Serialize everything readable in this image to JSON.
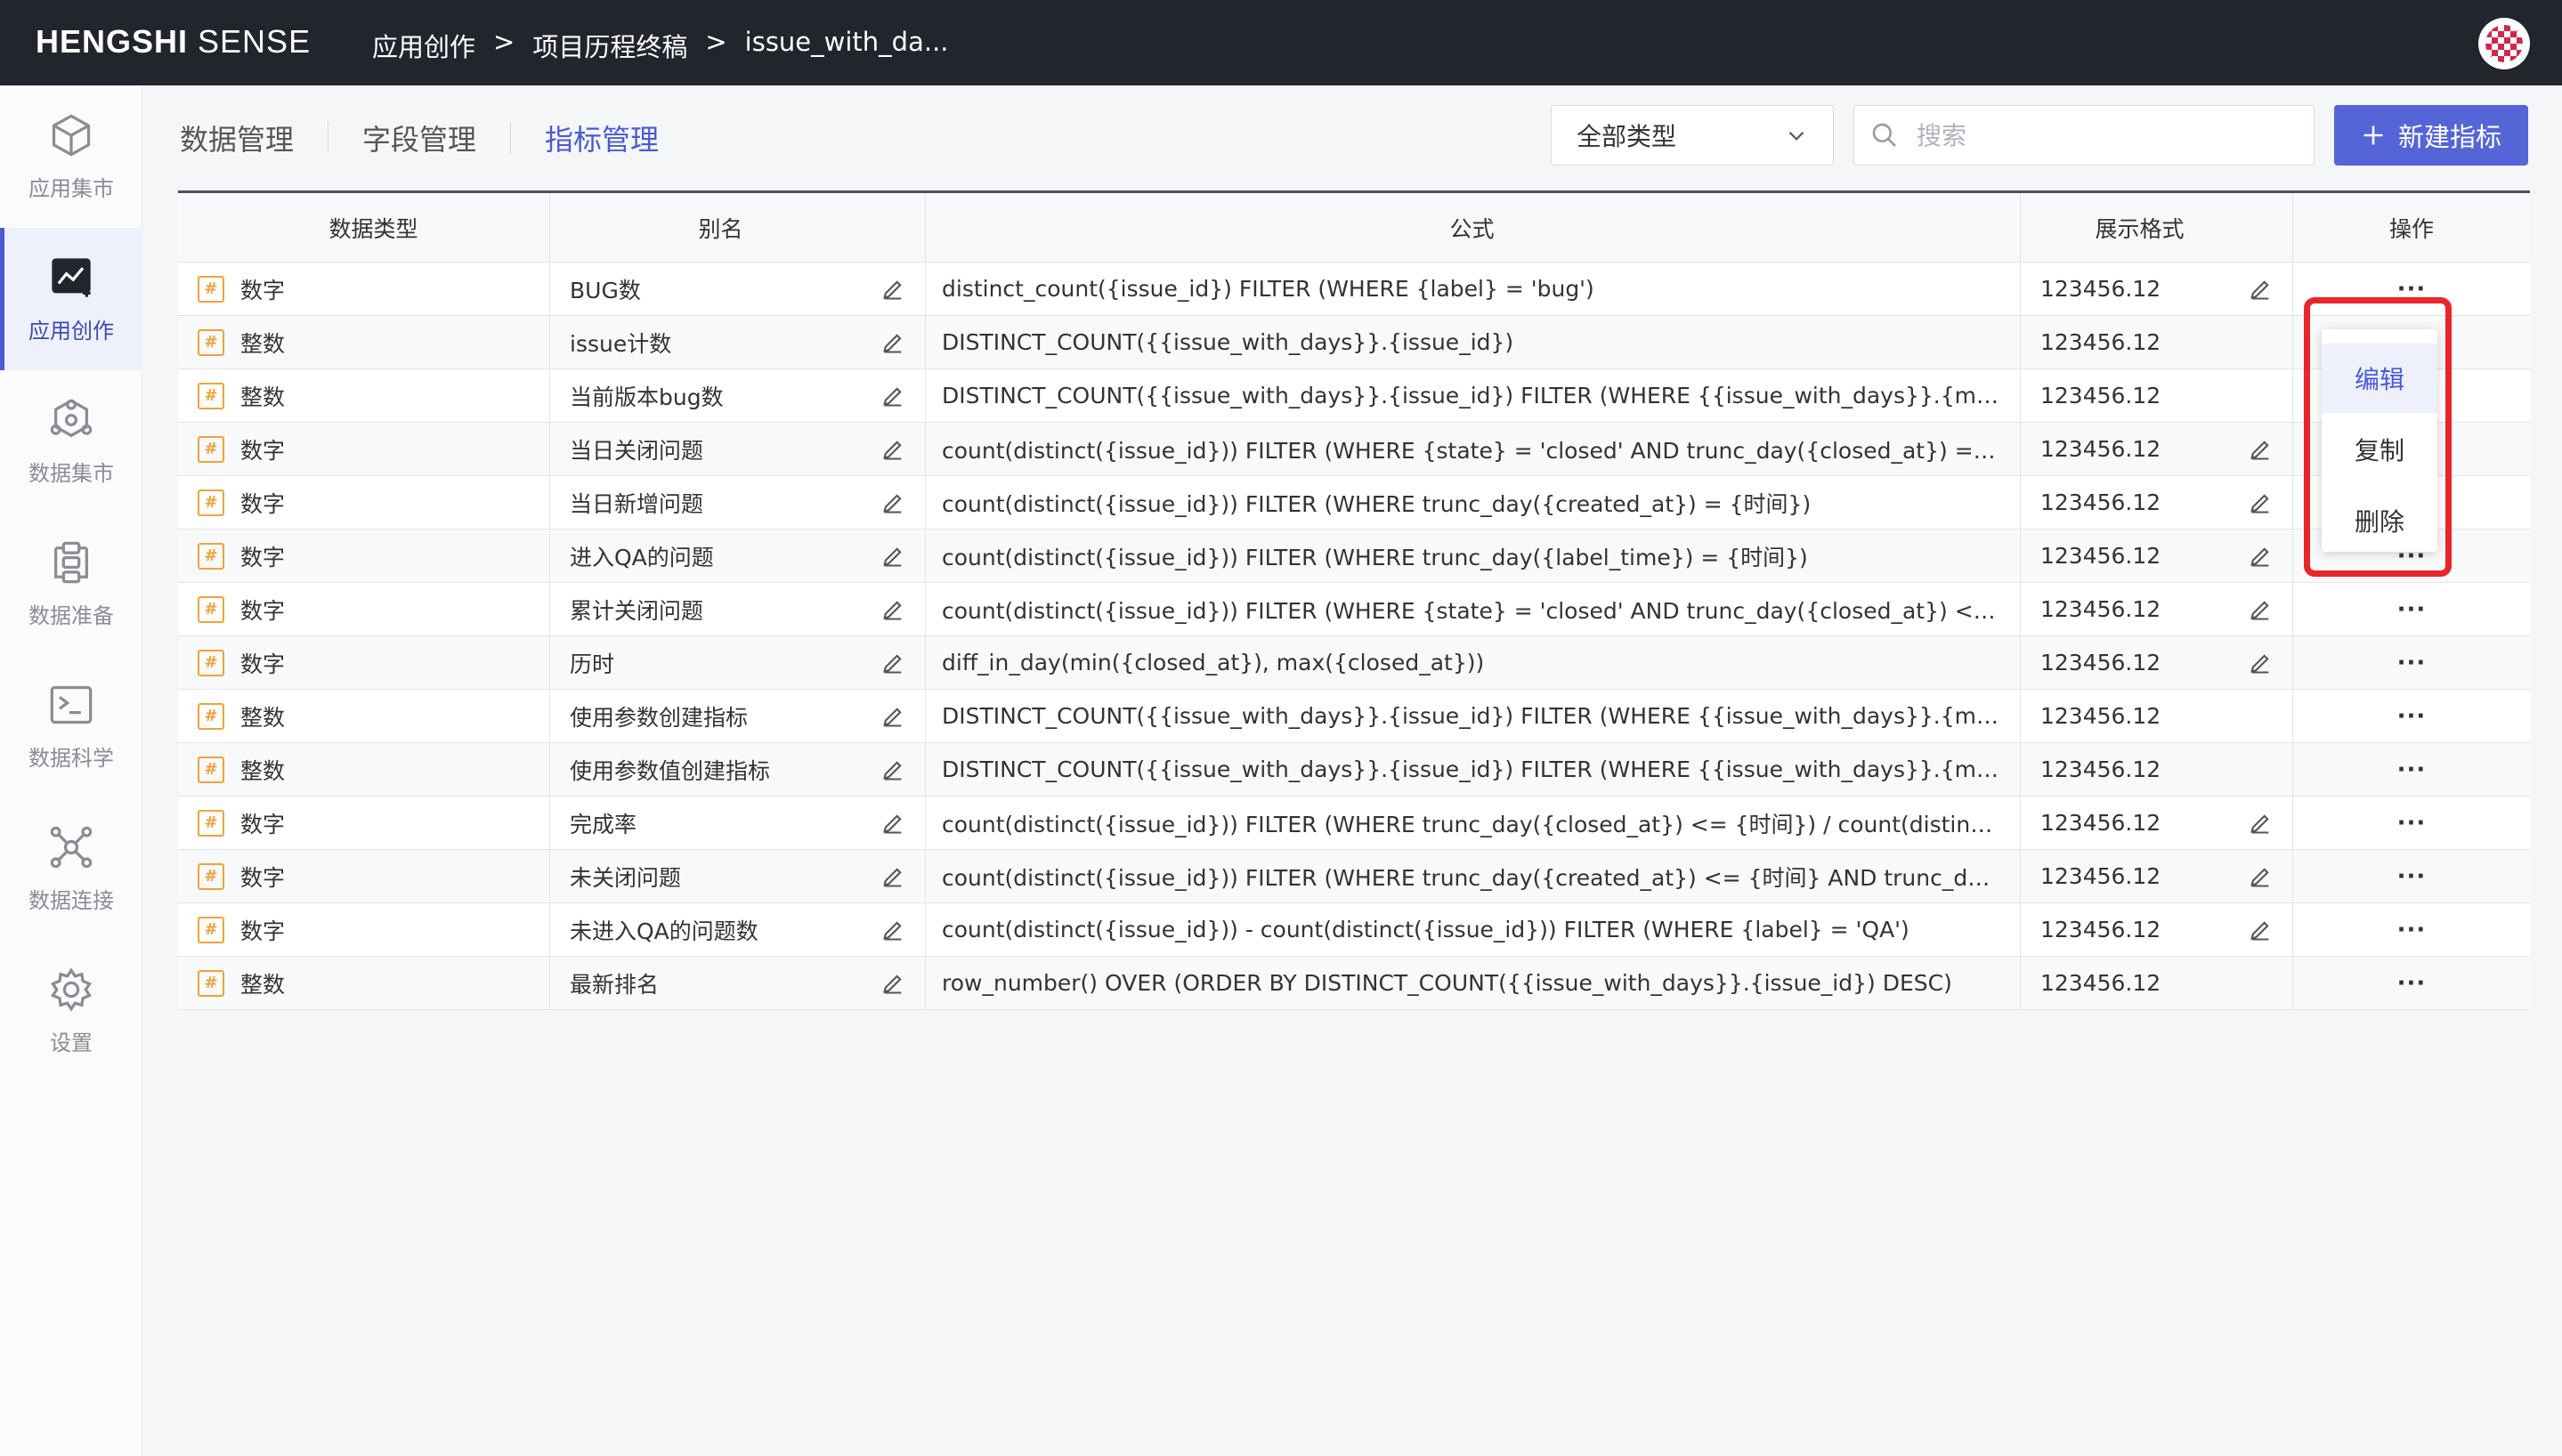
{
  "topbar": {
    "logo_bold": "HENGSHI",
    "logo_light": " SENSE",
    "breadcrumb": [
      "应用创作",
      "项目历程终稿",
      "issue_with_da..."
    ],
    "separator": ">"
  },
  "sidebar": {
    "items": [
      {
        "label": "应用集市",
        "icon": "cube-icon"
      },
      {
        "label": "应用创作",
        "icon": "chart-create-icon"
      },
      {
        "label": "数据集市",
        "icon": "data-mart-icon"
      },
      {
        "label": "数据准备",
        "icon": "data-prep-icon"
      },
      {
        "label": "数据科学",
        "icon": "terminal-icon"
      },
      {
        "label": "数据连接",
        "icon": "connection-icon"
      },
      {
        "label": "设置",
        "icon": "gear-icon"
      }
    ],
    "active_index": 1
  },
  "tabs": [
    "数据管理",
    "字段管理",
    "指标管理"
  ],
  "active_tab": 2,
  "filter": {
    "selected": "全部类型"
  },
  "search": {
    "placeholder": "搜索"
  },
  "new_button": {
    "label": "新建指标",
    "icon": "plus-icon"
  },
  "table": {
    "headers": [
      "数据类型",
      "别名",
      "公式",
      "展示格式",
      "操作"
    ],
    "rows": [
      {
        "type": "数字",
        "alias": "BUG数",
        "formula": "distinct_count({issue_id}) FILTER (WHERE {label} = 'bug')",
        "format": "123456.12",
        "fmt_edit": true
      },
      {
        "type": "整数",
        "alias": "issue计数",
        "formula": "DISTINCT_COUNT({{issue_with_days}}.{issue_id})",
        "format": "123456.12",
        "fmt_edit": false
      },
      {
        "type": "整数",
        "alias": "当前版本bug数",
        "formula": "DISTINCT_COUNT({{issue_with_days}}.{issue_id}) FILTER (WHERE {{issue_with_days}}.{milestone} = {{%...",
        "format": "123456.12",
        "fmt_edit": false
      },
      {
        "type": "数字",
        "alias": "当日关闭问题",
        "formula": "count(distinct({issue_id})) FILTER (WHERE {state} = 'closed' AND trunc_day({closed_at}) = {时间})",
        "format": "123456.12",
        "fmt_edit": true
      },
      {
        "type": "数字",
        "alias": "当日新增问题",
        "formula": "count(distinct({issue_id})) FILTER (WHERE trunc_day({created_at}) = {时间})",
        "format": "123456.12",
        "fmt_edit": true
      },
      {
        "type": "数字",
        "alias": "进入QA的问题",
        "formula": "count(distinct({issue_id})) FILTER (WHERE trunc_day({label_time}) = {时间})",
        "format": "123456.12",
        "fmt_edit": true
      },
      {
        "type": "数字",
        "alias": "累计关闭问题",
        "formula": "count(distinct({issue_id})) FILTER (WHERE {state} = 'closed' AND trunc_day({closed_at}) <= {时间})",
        "format": "123456.12",
        "fmt_edit": true
      },
      {
        "type": "数字",
        "alias": "历时",
        "formula": "diff_in_day(min({closed_at}), max({closed_at}))",
        "format": "123456.12",
        "fmt_edit": true
      },
      {
        "type": "整数",
        "alias": "使用参数创建指标",
        "formula": "DISTINCT_COUNT({{issue_with_days}}.{issue_id}) FILTER (WHERE {{issue_with_days}}.{milestone} = {{%...",
        "format": "123456.12",
        "fmt_edit": false
      },
      {
        "type": "整数",
        "alias": "使用参数值创建指标",
        "formula": "DISTINCT_COUNT({{issue_with_days}}.{issue_id}) FILTER (WHERE {{issue_with_days}}.{milestone} = '{{%...",
        "format": "123456.12",
        "fmt_edit": false
      },
      {
        "type": "数字",
        "alias": "完成率",
        "formula": "count(distinct({issue_id})) FILTER (WHERE trunc_day({closed_at}) <= {时间}) / count(distinct({issue_id}))...",
        "format": "123456.12",
        "fmt_edit": true
      },
      {
        "type": "数字",
        "alias": "未关闭问题",
        "formula": "count(distinct({issue_id})) FILTER (WHERE trunc_day({created_at}) <= {时间} AND trunc_day({closed_at}...",
        "format": "123456.12",
        "fmt_edit": true
      },
      {
        "type": "数字",
        "alias": "未进入QA的问题数",
        "formula": "count(distinct({issue_id})) - count(distinct({issue_id})) FILTER (WHERE {label} = 'QA')",
        "format": "123456.12",
        "fmt_edit": true
      },
      {
        "type": "整数",
        "alias": "最新排名",
        "formula": "row_number() OVER (ORDER BY DISTINCT_COUNT({{issue_with_days}}.{issue_id}) DESC)",
        "format": "123456.12",
        "fmt_edit": false
      }
    ],
    "type_icon": "#",
    "op_label": "···"
  },
  "context_menu": {
    "items": [
      "编辑",
      "复制",
      "删除"
    ],
    "active_index": 0,
    "highlight_color": "#e8262a"
  },
  "colors": {
    "accent": "#4a5bd4",
    "topbar": "#23252d",
    "type_icon": "#f0a33a"
  }
}
